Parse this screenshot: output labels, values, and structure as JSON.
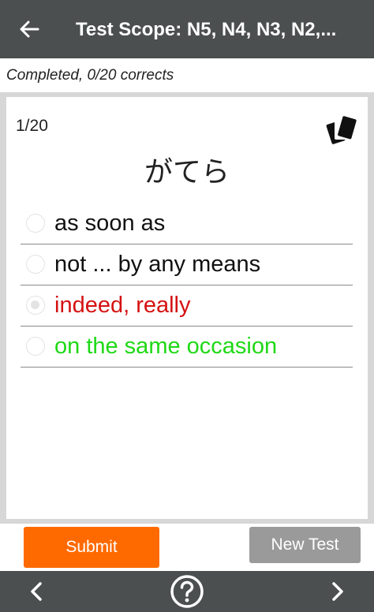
{
  "header": {
    "title": "Test Scope:  N5, N4, N3, N2,...",
    "back_icon": "arrow-left-icon"
  },
  "status": {
    "text": "Completed, 0/20 corrects"
  },
  "quiz": {
    "counter": "1/20",
    "flashcards_icon": "cards-icon",
    "question": "がてら",
    "options": [
      {
        "label": "as soon as",
        "color": "#111111",
        "checked": false
      },
      {
        "label": "not ... by any means",
        "color": "#111111",
        "checked": false
      },
      {
        "label": "indeed, really",
        "color": "#d51111",
        "checked": true
      },
      {
        "label": "on the same occasion",
        "color": "#1ed915",
        "checked": false
      }
    ]
  },
  "buttons": {
    "submit": "Submit",
    "new_test": "New Test"
  },
  "colors": {
    "app_bar": "#4b4f4f",
    "submit": "#ff6a00",
    "new_test": "#9a9a9a",
    "wrong": "#d51111",
    "correct": "#1ed915"
  },
  "nav": {
    "prev_icon": "chevron-left-icon",
    "help_icon": "help-circle-icon",
    "next_icon": "chevron-right-icon"
  }
}
